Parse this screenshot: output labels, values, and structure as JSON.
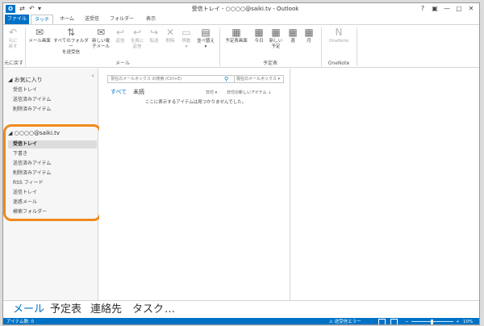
{
  "window": {
    "title": "受信トレイ - ○○○○@saiki.tv - Outlook",
    "app_icon": "O",
    "buttons": [
      "?",
      "▣",
      "—",
      "▢",
      "✕"
    ]
  },
  "qat": {
    "send_receive": "⇄",
    "undo": "↶",
    "more": "▾"
  },
  "tabs": [
    "ファイル",
    "タッチ",
    "ホーム",
    "送受信",
    "フォルダー",
    "表示"
  ],
  "ribbon": {
    "undo": {
      "label1": "元に",
      "label2": "戻す",
      "icon": "↶"
    },
    "mail_buttons": [
      {
        "label1": "メール画面",
        "label2": "",
        "icon": "✉"
      },
      {
        "label1": "すべてのフォルダー",
        "label2": "を送受信",
        "icon": "⇅"
      },
      {
        "label1": "新しい電",
        "label2": "子メール",
        "icon": "✉"
      },
      {
        "label1": "返信",
        "label2": "",
        "icon": "↩"
      },
      {
        "label1": "全員に",
        "label2": "返信",
        "icon": "↩"
      },
      {
        "label1": "転送",
        "label2": "",
        "icon": "↪"
      },
      {
        "label1": "削除",
        "label2": "",
        "icon": "✕"
      },
      {
        "label1": "移動",
        "label2": "▾",
        "icon": "▭"
      },
      {
        "label1": "並べ替え",
        "label2": "▾",
        "icon": "▤"
      }
    ],
    "calendar_buttons": [
      {
        "label1": "予定表画面",
        "icon": "▦"
      },
      {
        "label1": "今日",
        "icon": "▦"
      },
      {
        "label1": "新しい",
        "label2": "予定",
        "icon": "▦"
      },
      {
        "label1": "週",
        "icon": "▦"
      },
      {
        "label1": "月",
        "icon": "▦"
      }
    ],
    "onenote_button": {
      "label1": "OneNote",
      "icon": "N"
    },
    "groups": [
      "元に戻す",
      "メール",
      "予定表",
      "OneNote"
    ]
  },
  "folders": {
    "collapse": "‹",
    "favorites": {
      "header": "◢ お気に入り",
      "items": [
        "受信トレイ",
        "送信済みアイテム",
        "削除済みアイテム"
      ]
    },
    "account": {
      "header": "◢ ○○○○@saiki.tv",
      "items": [
        "受信トレイ",
        "下書き",
        "送信済みアイテム",
        "削除済みアイテム",
        "RSS フィード",
        "送信トレイ",
        "迷惑メール",
        "検索フォルダー"
      ]
    }
  },
  "list": {
    "search_placeholder": "現在のメールボックス の検索 (Ctrl+E)",
    "scope": "現在のメールボックス ▾",
    "filter_all": "すべて",
    "filter_unread": "未読",
    "sort_by": "日付 ▾",
    "sort_order": "日付の新しいアイテム ↓",
    "empty_message": "ここに表示するアイテムは見つかりませんでした。"
  },
  "nav": [
    "メール",
    "予定表",
    "連絡先",
    "タスク",
    "…"
  ],
  "status": {
    "item_count": "アイテム数: 0",
    "send_receive_error": "⚠ 送受信エラー",
    "zoom_minus": "−",
    "zoom_plus": "+",
    "zoom_level": "10%"
  },
  "colors": {
    "accent": "#0072c6",
    "highlight": "#f08a1c"
  }
}
